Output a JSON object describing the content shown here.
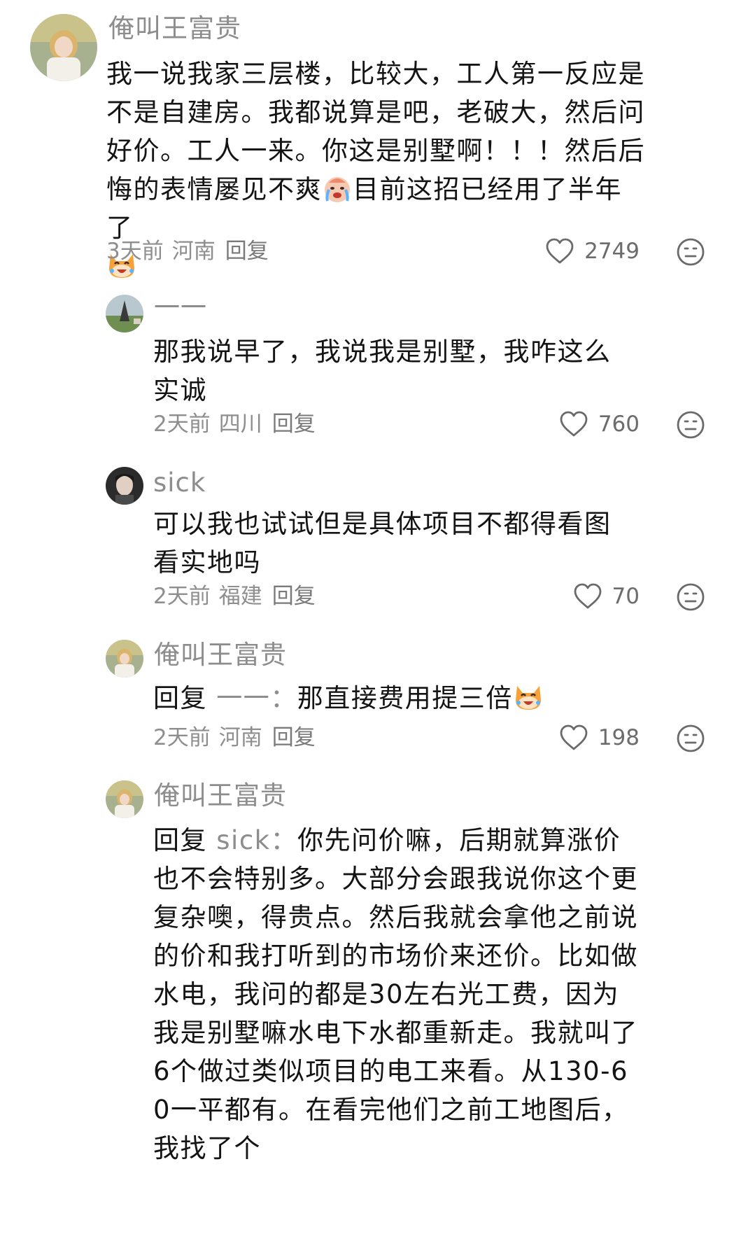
{
  "comments": [
    {
      "username": "俺叫王富贵",
      "text_part1": "我一说我家三层楼，比较大，工人第一反应是不是自建房。我都说算是吧，老破大，然后问好价。工人一来。你这是别墅啊！！！然后后悔的表情屡见不爽",
      "text_part2": "目前这招已经用了半年了",
      "time": "3天前",
      "location": "河南",
      "reply_label": "回复",
      "likes": "2749"
    },
    {
      "username": "一一",
      "text": "那我说早了，我说我是别墅，我咋这么实诚",
      "time": "2天前",
      "location": "四川",
      "reply_label": "回复",
      "likes": "760"
    },
    {
      "username": "sick",
      "text": "可以我也试试但是具体项目不都得看图看实地吗",
      "time": "2天前",
      "location": "福建",
      "reply_label": "回复",
      "likes": "70"
    },
    {
      "username": "俺叫王富贵",
      "reply_prefix": "回复",
      "reply_to": "一一：",
      "text": "那直接费用提三倍",
      "time": "2天前",
      "location": "河南",
      "reply_label": "回复",
      "likes": "198"
    },
    {
      "username": "俺叫王富贵",
      "reply_prefix": "回复",
      "reply_to": "sick：",
      "text": "你先问价嘛，后期就算涨价也不会特别多。大部分会跟我说你这个更复杂噢，得贵点。然后我就会拿他之前说的价和我打听到的市场价来还价。比如做水电，我问的都是30左右光工费，因为我是别墅嘛水电下水都重新走。我就叫了6个做过类似项目的电工来看。从130-60一平都有。在看完他们之前工地图后，我找了个"
    }
  ],
  "icons": {
    "like": "heart-outline-icon",
    "dislike": "unhappy-face-icon",
    "emoji_crying_baby": "crying-baby-emoji",
    "emoji_cat_laugh": "laughing-cat-emoji"
  },
  "colors": {
    "text": "#141414",
    "secondary": "#8d8d8d",
    "background": "#ffffff"
  }
}
